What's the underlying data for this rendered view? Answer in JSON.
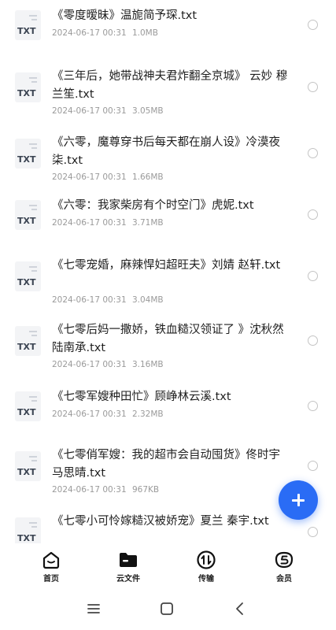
{
  "files": [
    {
      "title": "《零度暧昧》温旎简予琛.txt",
      "date": "2024-06-17 00:31",
      "size": "1.0MB",
      "ext": "TXT"
    },
    {
      "title": "《三年后，她带战神夫君炸翻全京城》 云妙 穆兰笙.txt",
      "date": "2024-06-17 00:31",
      "size": "3.05MB",
      "ext": "TXT"
    },
    {
      "title": "《六零，魔尊穿书后每天都在崩人设》冷漠夜柒.txt",
      "date": "2024-06-17 00:31",
      "size": "1.66MB",
      "ext": "TXT"
    },
    {
      "title": "《六零：我家柴房有个时空门》虎妮.txt",
      "date": "2024-06-17 00:31",
      "size": "3.71MB",
      "ext": "TXT"
    },
    {
      "title": "《七零宠婚，麻辣悍妇超旺夫》刘婧 赵轩.txt",
      "date": "2024-06-17 00:31",
      "size": "3.04MB",
      "ext": "TXT"
    },
    {
      "title": "《七零后妈一撒娇，铁血糙汉领证了 》沈秋然 陆南承.txt",
      "date": "2024-06-17 00:31",
      "size": "3.16MB",
      "ext": "TXT"
    },
    {
      "title": "《七零军嫂种田忙》顾峥林云溪.txt",
      "date": "2024-06-17 00:31",
      "size": "2.32MB",
      "ext": "TXT"
    },
    {
      "title": "《七零俏军嫂：我的超市会自动囤货》佟时宇马思晴.txt",
      "date": "2024-06-17 00:31",
      "size": "967KB",
      "ext": "TXT"
    },
    {
      "title": "《七零小可怜嫁糙汉被娇宠》夏兰 秦宇.txt",
      "date": "",
      "size": "",
      "ext": "TXT"
    }
  ],
  "tabs": [
    {
      "label": "首页",
      "icon": "home-icon"
    },
    {
      "label": "云文件",
      "icon": "folder-icon"
    },
    {
      "label": "传输",
      "icon": "transfer-icon"
    },
    {
      "label": "会员",
      "icon": "vip-icon"
    }
  ],
  "fab": {
    "icon": "plus-icon"
  },
  "system_nav": [
    "menu-icon",
    "home-square-icon",
    "back-icon"
  ],
  "colors": {
    "accent": "#2a6cf5",
    "meta": "#9a9a9a"
  }
}
